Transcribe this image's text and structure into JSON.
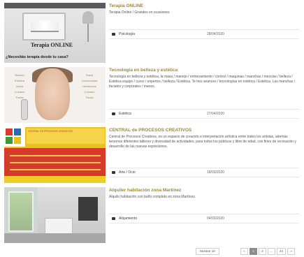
{
  "listing": {
    "items": [
      {
        "title": "Terapia ONLINE",
        "description": "Terapia Online / Grandes en ocasiones",
        "category": "Psicología",
        "date": "28/04/2020",
        "thumb_banner": "Terapia ONLINE",
        "thumb_tagline": "¿Necesitás terapia desde tu casa?"
      },
      {
        "title": "Tecnología en belleza y estética",
        "description": "Tecnología en belleza y estética, la masa / manejo / entrenamiento / control / maquinas / manchas / mezclas / belleza / Estética equipo / curso / expertos / belleza / Estética. Te tres avances / tecnologías en estética / Estética. Las manchas / faciales y corporales / manos.",
        "category": "Estética",
        "date": "27/04/2020",
        "thumb_left_col": [
          "Belleza",
          "Estética",
          "Salud",
          "Cuidado",
          "Facial"
        ],
        "thumb_right_col": [
          "Salud",
          "Luminosidad",
          "Hidratación",
          "Cuidado",
          "Facial"
        ]
      },
      {
        "title": "CENTRAL de PROCESOS CREATIVOS",
        "description": "Central de Procesos Creativos, es un espacio de creación e interpretación artística entre todos los artistas, además tenemos diferentes talleres y diversidad de actividades, para todos los públicos y libre de edad, con fines de recreación y desarrollo de las nuevas expresiones.",
        "category": "Arte / Ocio",
        "date": "18/03/2020",
        "thumb_top_text": "CENTRAL DE PROCESOS CREATIVOS"
      },
      {
        "title": "Alquiler habitación zona Martínez",
        "description": "Alquilo habitación con baño completo en zona Martínez.",
        "category": "Alojamiento",
        "date": "04/03/2020"
      }
    ]
  },
  "pagination": {
    "first_label": "Mostrar 10",
    "prev_label": "«",
    "pages": [
      "1",
      "2",
      "...",
      "24"
    ],
    "next_label": "»",
    "active_page": "1"
  }
}
